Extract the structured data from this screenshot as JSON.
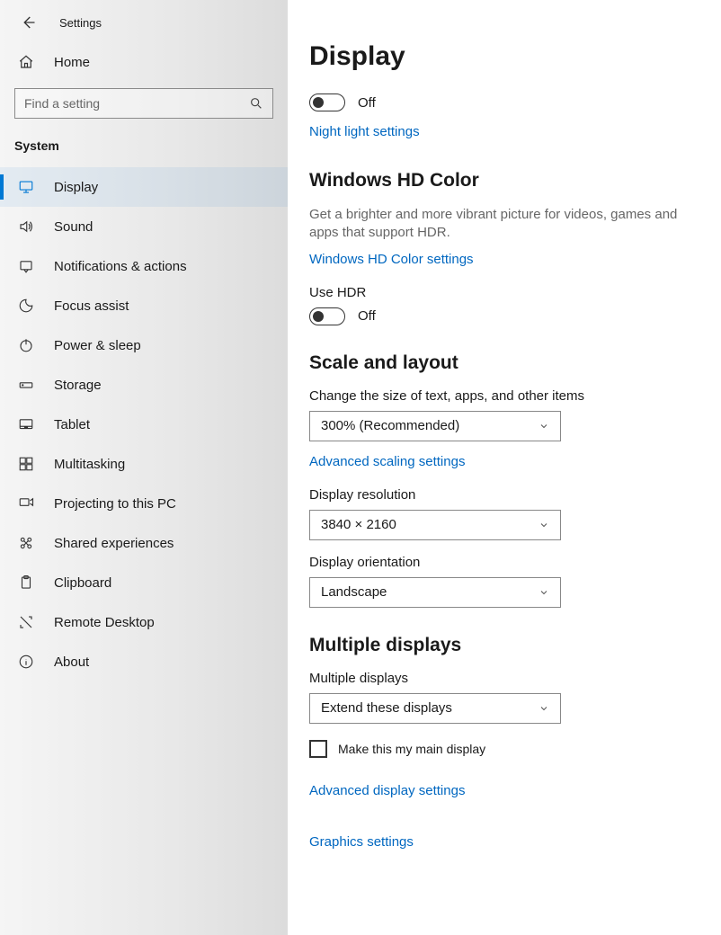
{
  "header": {
    "settings_label": "Settings"
  },
  "sidebar": {
    "home_label": "Home",
    "search_placeholder": "Find a setting",
    "section_label": "System",
    "items": [
      {
        "label": "Display",
        "icon": "display",
        "active": true
      },
      {
        "label": "Sound",
        "icon": "sound"
      },
      {
        "label": "Notifications & actions",
        "icon": "notifications"
      },
      {
        "label": "Focus assist",
        "icon": "focus"
      },
      {
        "label": "Power & sleep",
        "icon": "power"
      },
      {
        "label": "Storage",
        "icon": "storage"
      },
      {
        "label": "Tablet",
        "icon": "tablet"
      },
      {
        "label": "Multitasking",
        "icon": "multitask"
      },
      {
        "label": "Projecting to this PC",
        "icon": "project"
      },
      {
        "label": "Shared experiences",
        "icon": "shared"
      },
      {
        "label": "Clipboard",
        "icon": "clipboard"
      },
      {
        "label": "Remote Desktop",
        "icon": "remote"
      },
      {
        "label": "About",
        "icon": "about"
      }
    ]
  },
  "main": {
    "title": "Display",
    "night_toggle_state": "Off",
    "night_link": "Night light settings",
    "hdcolor": {
      "heading": "Windows HD Color",
      "desc": "Get a brighter and more vibrant picture for videos, games and apps that support HDR.",
      "link": "Windows HD Color settings",
      "use_hdr_label": "Use HDR",
      "hdr_toggle_state": "Off"
    },
    "scale": {
      "heading": "Scale and layout",
      "size_label": "Change the size of text, apps, and other items",
      "size_value": "300% (Recommended)",
      "advanced_link": "Advanced scaling settings",
      "resolution_label": "Display resolution",
      "resolution_value": "3840 × 2160",
      "orientation_label": "Display orientation",
      "orientation_value": "Landscape"
    },
    "multi": {
      "heading": "Multiple displays",
      "label": "Multiple displays",
      "value": "Extend these displays",
      "checkbox_label": "Make this my main display",
      "advanced_link": "Advanced display settings",
      "graphics_link": "Graphics settings"
    }
  }
}
